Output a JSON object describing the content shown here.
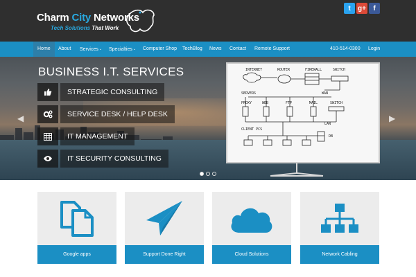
{
  "brand": {
    "name_part1": "Charm ",
    "name_part2": "City",
    "name_part3": " Networks",
    "tagline_part1": "Tech Solutions ",
    "tagline_part2": "That Work"
  },
  "social": [
    {
      "icon": "twitter-icon",
      "glyph": "t",
      "color": "#2aa3ef"
    },
    {
      "icon": "google-plus-icon",
      "glyph": "g+",
      "color": "#dc4a38"
    },
    {
      "icon": "facebook-icon",
      "glyph": "f",
      "color": "#3b5998"
    }
  ],
  "nav": {
    "home": "Home",
    "about": "About",
    "services": "Services",
    "specialties": "Specialties",
    "computer_shop": "Computer Shop",
    "techblog": "TechBlog",
    "news": "News",
    "contact": "Contact",
    "remote_support": "Remote Support",
    "phone": "410-514-0300",
    "login": "Login",
    "caret": "⌄"
  },
  "hero": {
    "title": "BUSINESS I.T. SERVICES",
    "services": [
      {
        "label": "STRATEGIC CONSULTING",
        "icon": "thumbs-up-icon"
      },
      {
        "label": "SERVICE DESK / HELP DESK",
        "icon": "gears-icon"
      },
      {
        "label": "IT MANAGEMENT",
        "icon": "table-icon"
      },
      {
        "label": "IT SECURITY CONSULTING",
        "icon": "eye-icon"
      }
    ],
    "prev_glyph": "◀",
    "next_glyph": "▶",
    "slide_index": 1,
    "slide_count": 3,
    "diagram": {
      "internet": "INTERNET",
      "router": "ROUTER",
      "firewall": "FIREWALL",
      "switch": "SWITCH",
      "servers": "SERVERS",
      "wan": "WAN",
      "proxy": "PROXY",
      "web": "WEB",
      "ftp": "FTP",
      "mail": "MAIL",
      "lan": "LAN",
      "client_pcs": "CLIENT PCS",
      "db": "DB"
    }
  },
  "cards": [
    {
      "label": "Google apps",
      "icon": "documents-icon"
    },
    {
      "label": "Support Done Right",
      "icon": "paper-plane-icon"
    },
    {
      "label": "Cloud Solutions",
      "icon": "cloud-icon"
    },
    {
      "label": "Network Cabling",
      "icon": "network-icon"
    }
  ],
  "colors": {
    "accent": "#1b8fc4",
    "header_bg": "#2f2f2f",
    "card_bg": "#ececec"
  }
}
